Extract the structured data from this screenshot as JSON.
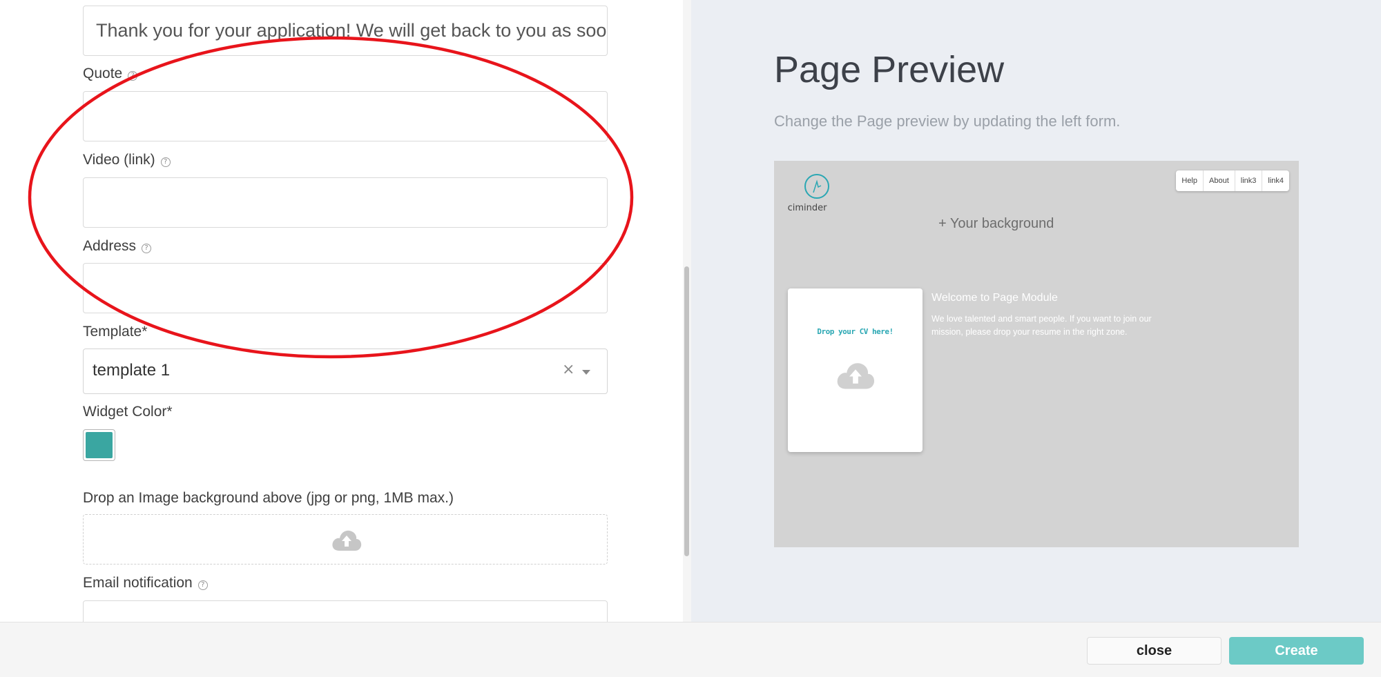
{
  "form": {
    "thankyou_value": "Thank you for your application! We will get back to you as soon as possible.",
    "quote_label": "Quote",
    "quote_value": "",
    "video_label": "Video (link)",
    "video_value": "",
    "address_label": "Address",
    "address_value": "",
    "template_label": "Template*",
    "template_value": "template 1",
    "widget_color_label": "Widget Color*",
    "widget_color": "#3aa6a1",
    "dropzone_label": "Drop an Image background above (jpg or png, 1MB max.)",
    "email_label": "Email notification",
    "help_glyph": "?",
    "clear_glyph": "×"
  },
  "preview": {
    "title": "Page Preview",
    "subtitle": "Change the Page preview by updating the left form.",
    "logo_text": "ciminder",
    "nav": [
      "Help",
      "About",
      "link3",
      "link4"
    ],
    "background_label": "+ Your background",
    "drop_cv": "Drop your CV here!",
    "welcome": "Welcome to Page Module",
    "intro": "We love talented and smart people. If you want to join our mission, please drop your resume in the right zone."
  },
  "footer": {
    "close_label": "close",
    "create_label": "Create"
  },
  "colors": {
    "annotation": "#e8141b",
    "accent": "#6ccac6"
  }
}
